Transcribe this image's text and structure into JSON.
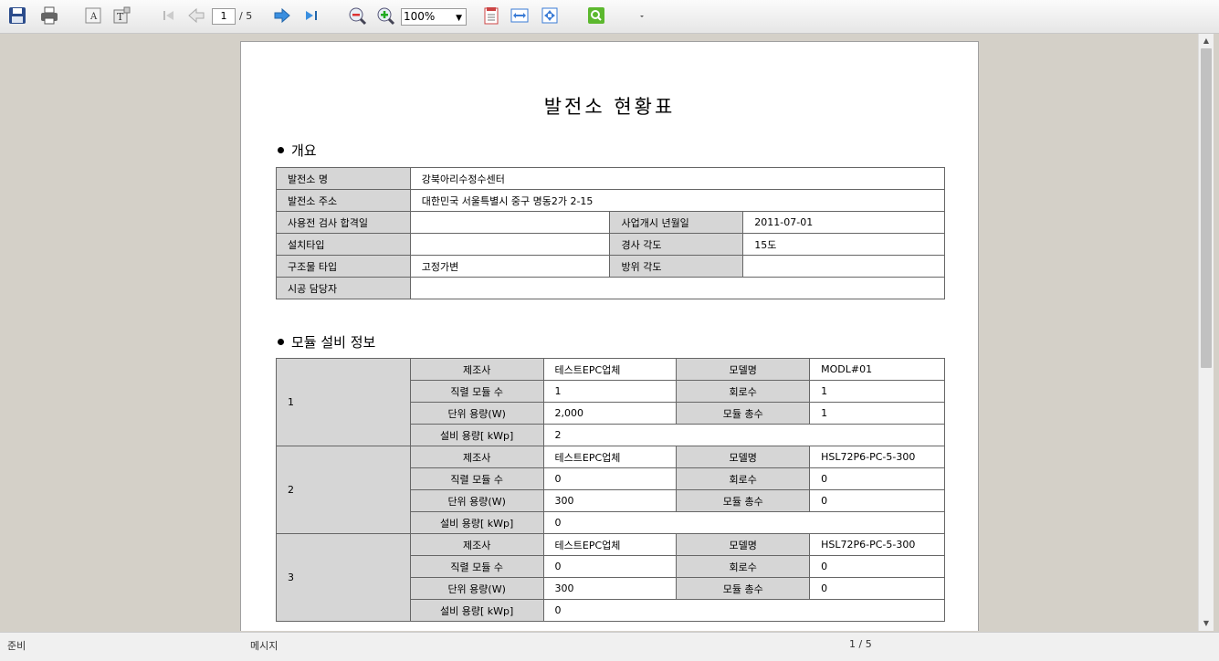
{
  "toolbar": {
    "current_page": "1",
    "page_count": "/ 5",
    "zoom": "100%"
  },
  "document": {
    "title": "발전소 현황표",
    "overview_heading": "개요",
    "overview": {
      "plant_name_label": "발전소 명",
      "plant_name": "강북아리수정수센터",
      "address_label": "발전소 주소",
      "address": "대한민국 서울특별시 중구 명동2가 2-15",
      "inspection_label": "사용전 검사 합격일",
      "inspection": "",
      "start_label": "사업개시 년월일",
      "start": "2011-07-01",
      "install_type_label": "설치타입",
      "install_type": "",
      "tilt_label": "경사 각도",
      "tilt": "15도",
      "structure_label": "구조물 타입",
      "structure": "고정가변",
      "azimuth_label": "방위 각도",
      "azimuth": "",
      "contractor_label": "시공 담당자",
      "contractor": ""
    },
    "module_heading": "모듈 설비 정보",
    "labels": {
      "maker": "제조사",
      "model": "모델명",
      "series": "직렬 모듈 수",
      "circuits": "회로수",
      "unit_cap": "단위 용량(W)",
      "total_modules": "모듈 총수",
      "facility_cap": "설비 용량[ kWp]"
    },
    "modules": [
      {
        "no": "1",
        "maker": "테스트EPC업체",
        "model": "MODL#01",
        "series": "1",
        "circuits": "1",
        "unit_cap": "2,000",
        "total": "1",
        "facility": "2"
      },
      {
        "no": "2",
        "maker": "테스트EPC업체",
        "model": "HSL72P6-PC-5-300",
        "series": "0",
        "circuits": "0",
        "unit_cap": "300",
        "total": "0",
        "facility": "0"
      },
      {
        "no": "3",
        "maker": "테스트EPC업체",
        "model": "HSL72P6-PC-5-300",
        "series": "0",
        "circuits": "0",
        "unit_cap": "300",
        "total": "0",
        "facility": "0"
      }
    ]
  },
  "status": {
    "state": "준비",
    "message": "메시지",
    "page": "1 / 5"
  }
}
